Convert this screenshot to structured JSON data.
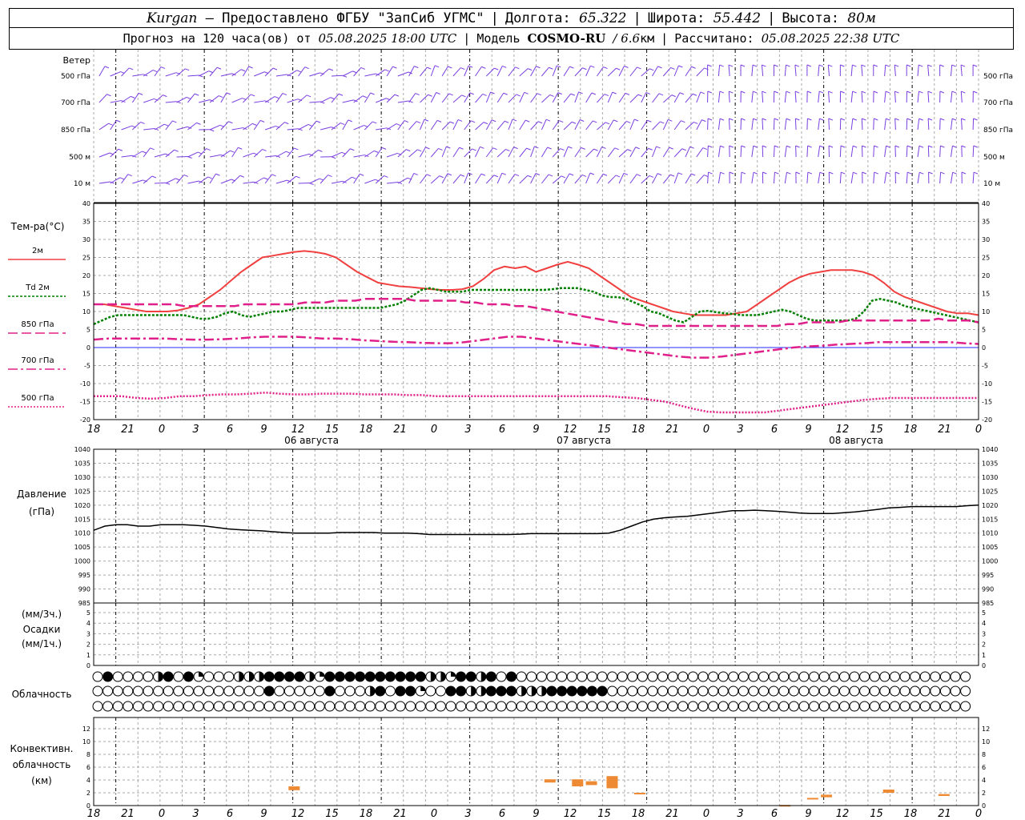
{
  "header": {
    "station": "Kurgan",
    "provider": "— Предоставлено ФГБУ \"ЗапСиб УГМС\"",
    "lon_label": "Долгота:",
    "lon_value": "65.322",
    "lat_label": "Широта:",
    "lat_value": "55.442",
    "alt_label": "Высота:",
    "alt_value": "80м",
    "forecast_prefix": "Прогноз на 120 часа(ов) от",
    "forecast_start": "05.08.2025 18:00 UTC",
    "model_label": "Модель",
    "model_name": "COSMO-RU",
    "model_res": "/ 6.6",
    "model_unit": "км",
    "calc_label": "Рассчитано:",
    "calc_time": "05.08.2025 22:38 UTC"
  },
  "wind_panel": {
    "title": "Ветер",
    "levels": [
      "500 гПа",
      "700 гПа",
      "850 гПа",
      "500 м",
      "10  м"
    ]
  },
  "temp_panel": {
    "title": "Тем-ра(°C)",
    "legend": [
      {
        "label": "2м",
        "color": "#f04040",
        "dash": ""
      },
      {
        "label": "Td  2м",
        "color": "#008000",
        "dash": "3,2"
      },
      {
        "label": "850 гПа",
        "color": "#e0208a",
        "dash": "12,5"
      },
      {
        "label": "700 гПа",
        "color": "#e0208a",
        "dash": "12,4,3,4"
      },
      {
        "label": "500 гПа",
        "color": "#e0208a",
        "dash": "2,2"
      }
    ]
  },
  "pressure_panel": {
    "title": "Давление",
    "unit": "(гПа)"
  },
  "precip_panel": {
    "unit1": "(мм/3ч.)",
    "title": "Осадки",
    "unit2": "(мм/1ч.)"
  },
  "cloud_panel": {
    "title": "Облачность"
  },
  "conv_panel": {
    "title1": "Конвективн.",
    "title2": "облачность",
    "unit": "(км)"
  },
  "time_axis": {
    "hour_labels": [
      "18",
      "21",
      "0",
      "3",
      "6",
      "9",
      "12",
      "15",
      "18",
      "21",
      "0",
      "3",
      "6",
      "9",
      "12",
      "15",
      "18",
      "21",
      "0",
      "3",
      "6",
      "9",
      "12",
      "15",
      "18",
      "21",
      "0"
    ],
    "day_labels": [
      "06 августа",
      "07 августа",
      "08 августа"
    ]
  },
  "chart_data": [
    {
      "type": "line",
      "title": "Тем-ра(°C)",
      "x": [
        0,
        3,
        6,
        9,
        12,
        15,
        18,
        21,
        24,
        27,
        30,
        33,
        36,
        39,
        42,
        45,
        48,
        51,
        54,
        57,
        60,
        63,
        66,
        69,
        72,
        75,
        78,
        81,
        84,
        87,
        90,
        93,
        96,
        99,
        102,
        105,
        108,
        111,
        114,
        117,
        120,
        123,
        126,
        129,
        132,
        135,
        138,
        141,
        144,
        147,
        150,
        153,
        156,
        159,
        162,
        165,
        168,
        171,
        174,
        177,
        180,
        183,
        186,
        189,
        192,
        195,
        198,
        201,
        204,
        207,
        210,
        213,
        216,
        219,
        222,
        225,
        228,
        231,
        234,
        237,
        240
      ],
      "x_unit": "hours from 05.08.2025 18:00 UTC",
      "ylim": [
        -20,
        40
      ],
      "yticks": [
        -20,
        -15,
        -10,
        -5,
        0,
        5,
        10,
        15,
        20,
        25,
        30,
        35,
        40
      ],
      "series": [
        {
          "name": "2м",
          "values": [
            12,
            12,
            11.5,
            11,
            10.5,
            10,
            10,
            10,
            10.3,
            11,
            12,
            14,
            16,
            18.5,
            21,
            23,
            25,
            25.5,
            26,
            26.5,
            26.8,
            26.5,
            26,
            25,
            23,
            21,
            19.5,
            18,
            17.5,
            17,
            16.8,
            16.5,
            16.2,
            16,
            16,
            16.2,
            17,
            19,
            21.5,
            22.5,
            22,
            22.5,
            21,
            22,
            23,
            23.8,
            23,
            22,
            20,
            18,
            16,
            14,
            13,
            12,
            11,
            10,
            9.5,
            9,
            9,
            9,
            9,
            9.5,
            10,
            12,
            14,
            16,
            18,
            19.5,
            20.5,
            21,
            21.5,
            21.5,
            21.5,
            21,
            20,
            18,
            15.5,
            14,
            13,
            12,
            11,
            10,
            9.5,
            9.5,
            9
          ]
        },
        {
          "name": "Td  2м",
          "values": [
            6.5,
            7.5,
            8.5,
            9,
            9,
            9,
            9,
            9,
            9,
            9,
            9,
            9,
            8.5,
            8,
            8,
            8.5,
            9.5,
            10,
            9,
            8.5,
            9,
            9.5,
            10,
            10,
            10.5,
            11,
            11,
            11,
            11,
            11,
            11,
            11,
            11,
            11,
            11,
            11,
            11.5,
            12,
            13,
            14.5,
            16,
            16.5,
            16,
            15.5,
            15.5,
            15.5,
            16,
            16,
            16,
            16,
            16,
            16,
            16,
            16,
            16,
            16,
            16.2,
            16.5,
            16.5,
            16.5,
            16,
            15.5,
            14.5,
            14,
            14,
            13.5,
            12.5,
            11.5,
            10,
            9.5,
            8.5,
            7.5,
            7,
            8.5,
            10,
            10.2,
            9.8,
            9.5,
            9.3,
            9,
            9,
            9,
            9.5,
            10,
            10.5,
            10,
            9,
            8,
            7.5,
            7.5,
            7.5,
            7.5,
            7.5,
            8,
            10,
            13,
            13.5,
            13,
            12.5,
            11.5,
            11,
            10.5,
            10,
            9.5,
            9,
            8.5,
            8,
            7.5,
            7
          ]
        },
        {
          "name": "850 гПа",
          "values": [
            12,
            12,
            12,
            12,
            12,
            12,
            12,
            12,
            12,
            11.5,
            11.5,
            11.5,
            11.5,
            11.5,
            11.5,
            12,
            12,
            12,
            12,
            12,
            12,
            12.5,
            12.5,
            12.5,
            13,
            13,
            13,
            13.5,
            13.5,
            13.5,
            13.5,
            13.5,
            13,
            13,
            13,
            13,
            13,
            12.5,
            12.5,
            12,
            12,
            12,
            11.5,
            11.5,
            11,
            10.5,
            10,
            9.5,
            9,
            8.5,
            8,
            7.5,
            7,
            6.5,
            6.5,
            6,
            6,
            6,
            6,
            6,
            6,
            6,
            6,
            6,
            6,
            6,
            6,
            6,
            6,
            6.5,
            6.5,
            7,
            7,
            7,
            7,
            7.5,
            7.5,
            7.5,
            7.5,
            7.5,
            7.5,
            7.5,
            7.5,
            7.5,
            8,
            7.5,
            7.5,
            7.5,
            7
          ]
        },
        {
          "name": "700 гПа",
          "values": [
            2.2,
            2.5,
            2.5,
            2.5,
            2.5,
            2.5,
            2.3,
            2.2,
            2.2,
            2.3,
            2.5,
            2.8,
            3,
            3,
            3,
            2.8,
            2.5,
            2.5,
            2.3,
            2,
            1.8,
            1.6,
            1.5,
            1.3,
            1.2,
            1.2,
            1.5,
            2,
            2.5,
            3,
            3,
            2.5,
            2,
            1.5,
            1,
            0.5,
            0,
            -0.5,
            -1,
            -1.5,
            -2,
            -2.5,
            -2.8,
            -2.8,
            -2.5,
            -2,
            -1.5,
            -1,
            -0.5,
            0,
            0.3,
            0.5,
            0.8,
            1,
            1.2,
            1.5,
            1.5,
            1.5,
            1.5,
            1.5,
            1.5,
            1.2,
            1
          ]
        },
        {
          "name": "500 гПа",
          "values": [
            -13.5,
            -13.5,
            -13.5,
            -14,
            -14.2,
            -14,
            -13.5,
            -13.5,
            -13.2,
            -13,
            -13,
            -12.8,
            -12.5,
            -12.8,
            -13,
            -13,
            -12.8,
            -12.8,
            -12.8,
            -13,
            -13,
            -13,
            -13.2,
            -13.2,
            -13.5,
            -13.5,
            -13.5,
            -13.5,
            -13.5,
            -13.5,
            -13.5,
            -13.5,
            -13.5,
            -13.5,
            -13.5,
            -13.5,
            -13.5,
            -13.8,
            -14,
            -14.5,
            -15,
            -16,
            -17,
            -17.8,
            -18,
            -18,
            -18,
            -18,
            -17.5,
            -17,
            -16.5,
            -16,
            -15.5,
            -15,
            -14.5,
            -14.2,
            -14,
            -14,
            -14,
            -14,
            -14,
            -14,
            -14
          ]
        }
      ]
    },
    {
      "type": "line",
      "title": "Давление",
      "ylabel": "(гПа)",
      "ylim": [
        985,
        1040
      ],
      "yticks": [
        985,
        990,
        995,
        1000,
        1005,
        1010,
        1015,
        1020,
        1025,
        1030,
        1035,
        1040
      ],
      "series": [
        {
          "name": "",
          "values": [
            1011,
            1012.5,
            1013,
            1013,
            1012.5,
            1012.5,
            1013,
            1013,
            1013,
            1012.8,
            1012.5,
            1012,
            1011.5,
            1011.2,
            1011,
            1010.8,
            1010.5,
            1010.2,
            1010,
            1010,
            1010,
            1010,
            1010.2,
            1010.2,
            1010.2,
            1010.2,
            1010,
            1010,
            1010,
            1009.8,
            1009.5,
            1009.5,
            1009.5,
            1009.5,
            1009.5,
            1009.5,
            1009.5,
            1009.5,
            1009.6,
            1009.8,
            1009.8,
            1009.8,
            1009.8,
            1009.8,
            1009.8,
            1009.8,
            1010,
            1011,
            1012.5,
            1014,
            1015,
            1015.5,
            1015.8,
            1016,
            1016.5,
            1017,
            1017.5,
            1018,
            1018,
            1018.2,
            1018,
            1017.8,
            1017.5,
            1017.2,
            1017,
            1017,
            1017,
            1017.3,
            1017.6,
            1018,
            1018.5,
            1019,
            1019.2,
            1019.5,
            1019.5,
            1019.5,
            1019.5,
            1019.5,
            1019.8,
            1020
          ]
        }
      ]
    },
    {
      "type": "bar",
      "title": "Осадки",
      "ylabel": "(мм/3ч.) (мм/1ч.)",
      "ylim": [
        0,
        5
      ],
      "yticks": [
        0,
        1,
        2,
        3,
        4,
        5
      ],
      "values": []
    },
    {
      "type": "table",
      "title": "Облачность",
      "rows": [
        "010000210130002221111231111111111223112101000000000000000000000000000000000000000000000",
        "000000000000000001000001000210113001122111222111111000000000000000000000000000000000000",
        "000000000000000000000000000000000000000000000000000000000000000000000000000000000000000"
      ],
      "encoding": "0 clear, 1 overcast, 2 half, 3 split"
    },
    {
      "type": "bar",
      "title": "Конвективн. облачность",
      "ylabel": "(км)",
      "ylim": [
        0,
        13
      ],
      "yticks": [
        0,
        2,
        4,
        6,
        8,
        10,
        12
      ],
      "bars": [
        {
          "x": 14.5,
          "bottom": 2.4,
          "top": 3.0
        },
        {
          "x": 33,
          "bottom": 3.6,
          "top": 4.1
        },
        {
          "x": 35,
          "bottom": 3.0,
          "top": 4.1
        },
        {
          "x": 36,
          "bottom": 3.2,
          "top": 3.8
        },
        {
          "x": 37.5,
          "bottom": 2.7,
          "top": 4.6
        },
        {
          "x": 39.5,
          "bottom": 1.8,
          "top": 2.0
        },
        {
          "x": 50,
          "bottom": 0,
          "top": 0.1
        },
        {
          "x": 52,
          "bottom": 1.0,
          "top": 1.2
        },
        {
          "x": 53,
          "bottom": 1.3,
          "top": 1.7
        },
        {
          "x": 57.5,
          "bottom": 2.0,
          "top": 2.5
        },
        {
          "x": 61.5,
          "bottom": 1.5,
          "top": 1.8
        }
      ]
    }
  ]
}
